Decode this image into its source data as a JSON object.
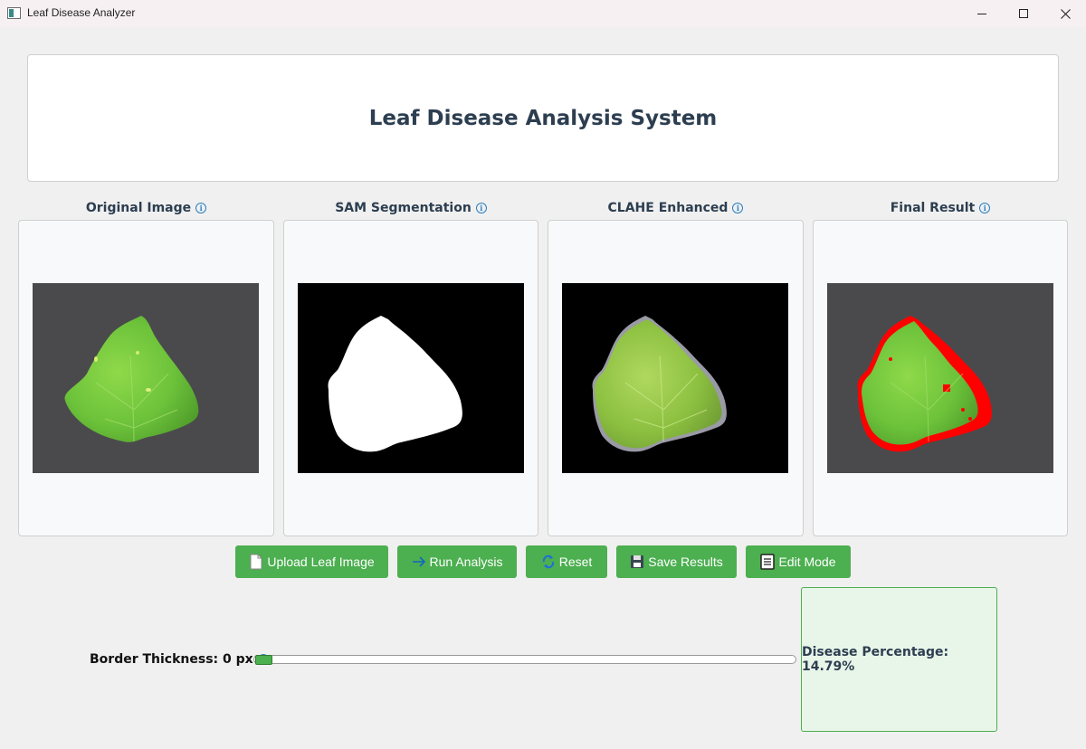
{
  "window": {
    "title": "Leaf Disease Analyzer"
  },
  "header": {
    "title": "Leaf Disease Analysis System"
  },
  "panels": [
    {
      "label": "Original Image"
    },
    {
      "label": "SAM Segmentation"
    },
    {
      "label": "CLAHE Enhanced"
    },
    {
      "label": "Final Result"
    }
  ],
  "buttons": {
    "upload": "Upload Leaf Image",
    "run": "Run Analysis",
    "reset": "Reset",
    "save": "Save Results",
    "edit": "Edit Mode"
  },
  "slider": {
    "label": "Border Thickness: 0 px",
    "value": 0
  },
  "result": {
    "text": "Disease Percentage: 14.79%"
  },
  "colors": {
    "accent": "#4caf50",
    "title": "#2c3e50",
    "info": "#2a7fc0",
    "disease": "#ff0000"
  }
}
